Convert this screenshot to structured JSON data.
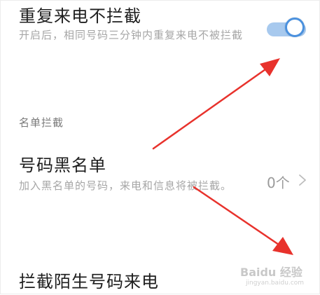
{
  "settings": {
    "repeat_call": {
      "title": "重复来电不拦截",
      "description": "开启后，相同号码三分钟内重复来电不被拦截",
      "toggle_state": "on"
    },
    "section_header": "名单拦截",
    "blacklist": {
      "title": "号码黑名单",
      "description": "加入黑名单的号码，来电和信息将被拦截。",
      "count_label": "0个"
    },
    "stranger_block": {
      "title": "拦截陌生号码来电"
    }
  },
  "watermark": {
    "brand": "Baidu 经验",
    "sub": "jingyan.baidu.com"
  },
  "colors": {
    "accent": "#4b91de",
    "toggle_track": "#a7c9ee",
    "annotation_arrow": "#e8322c",
    "title_text": "#1e1e1e",
    "desc_text": "#a6a6a6"
  },
  "icons": {
    "chevron": "chevron-right-icon",
    "arrows": "annotation-arrow-icon"
  }
}
